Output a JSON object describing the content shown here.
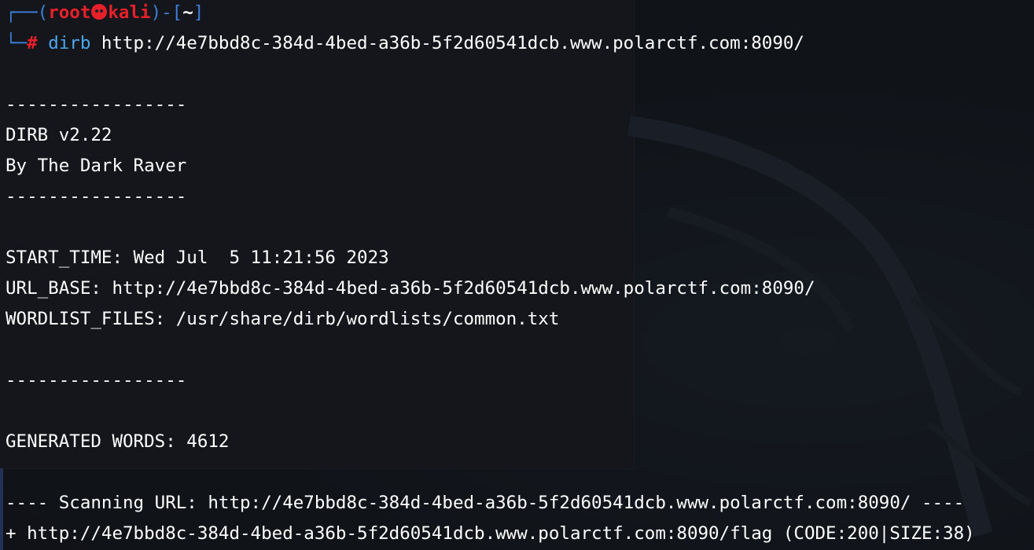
{
  "prompt": {
    "box_top": "┌──(",
    "user": "root",
    "host": "kali",
    "mid": ")-[",
    "cwd": "~",
    "close": "]",
    "box_bottom": "└─",
    "hash": "#",
    "command": "dirb",
    "argument": "http://4e7bbd8c-384d-4bed-a36b-5f2d60541dcb.www.polarctf.com:8090/"
  },
  "output": {
    "sep1": "-----------------",
    "version": "DIRB v2.22",
    "author": "By The Dark Raver",
    "sep2": "-----------------",
    "start_time": "START_TIME: Wed Jul  5 11:21:56 2023",
    "url_base": "URL_BASE: http://4e7bbd8c-384d-4bed-a36b-5f2d60541dcb.www.polarctf.com:8090/",
    "wordlist": "WORDLIST_FILES: /usr/share/dirb/wordlists/common.txt",
    "sep3": "-----------------",
    "generated": "GENERATED WORDS: 4612",
    "scanning": "---- Scanning URL: http://4e7bbd8c-384d-4bed-a36b-5f2d60541dcb.www.polarctf.com:8090/ ----",
    "result": "+ http://4e7bbd8c-384d-4bed-a36b-5f2d60541dcb.www.polarctf.com:8090/flag (CODE:200|SIZE:38)"
  },
  "colors": {
    "prompt_box": "#3c7fd9",
    "prompt_user": "#e8202a",
    "command": "#4aa8f0",
    "text": "#ffffff"
  }
}
